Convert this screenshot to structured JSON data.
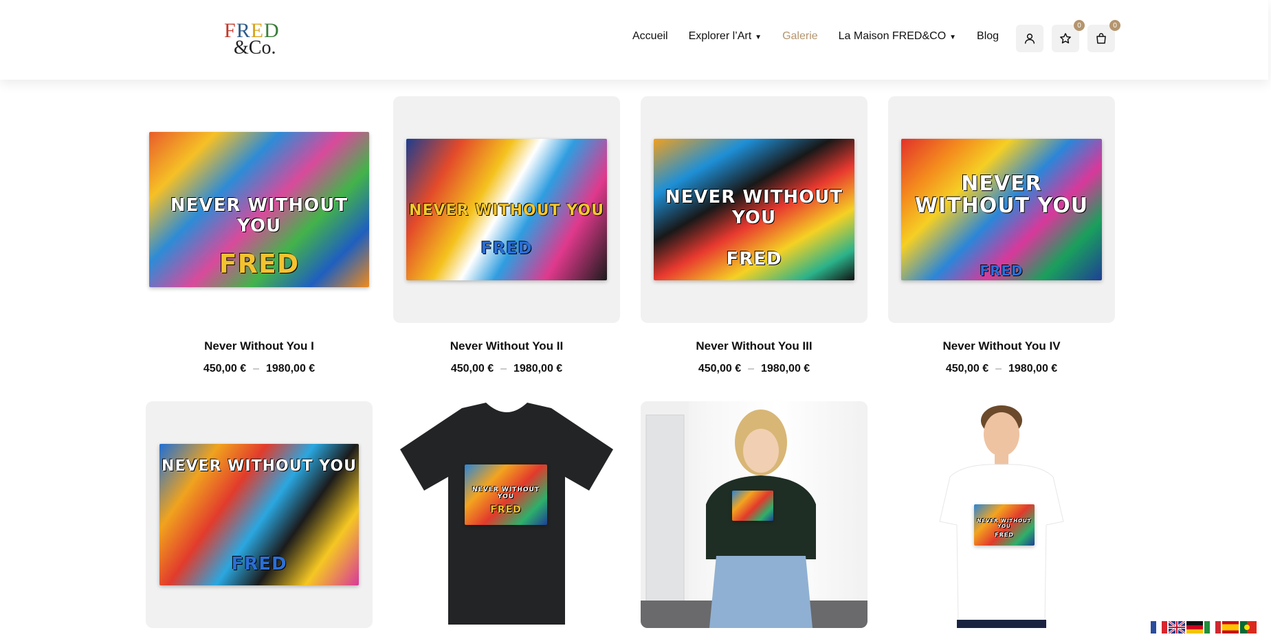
{
  "header": {
    "logo_line1": [
      "F",
      "R",
      "E",
      "D"
    ],
    "logo_line2": "&Co.",
    "nav": [
      {
        "label": "Accueil",
        "dropdown": false,
        "active": false
      },
      {
        "label": "Explorer l’Art",
        "dropdown": true,
        "active": false
      },
      {
        "label": "Galerie",
        "dropdown": false,
        "active": true
      },
      {
        "label": "La Maison FRED&CO",
        "dropdown": true,
        "active": false
      },
      {
        "label": "Blog",
        "dropdown": false,
        "active": false
      }
    ],
    "icons": [
      "user-icon",
      "star-icon",
      "bag-icon"
    ],
    "wishlist_count": "0",
    "cart_count": "0",
    "accent_color": "#b4956e"
  },
  "products": [
    {
      "title": "Never Without You I",
      "price_min": "450,00 €",
      "price_sep": "–",
      "price_max": "1980,00 €",
      "art_text": "NEVER WITHOUT YOU",
      "art_sign": "FRED"
    },
    {
      "title": "Never Without You II",
      "price_min": "450,00 €",
      "price_sep": "–",
      "price_max": "1980,00 €",
      "art_text": "NEVER WITHOUT YOU",
      "art_sign": "FRED"
    },
    {
      "title": "Never Without You III",
      "price_min": "450,00 €",
      "price_sep": "–",
      "price_max": "1980,00 €",
      "art_text": "NEVER WITHOUT YOU",
      "art_sign": "FRED"
    },
    {
      "title": "Never Without You IV",
      "price_min": "450,00 €",
      "price_sep": "–",
      "price_max": "1980,00 €",
      "art_text": "NEVER WITHOUT YOU",
      "art_sign": "FRED"
    },
    {
      "art_text": "NEVER WITHOUT YOU",
      "art_sign": "FRED"
    },
    {
      "art_text": "NEVER WITHOUT YOU",
      "art_sign": "FRED"
    },
    {
      "art_text": "",
      "art_sign": ""
    },
    {
      "art_text": "NEVER WITHOUT YOU",
      "art_sign": "FRED"
    }
  ],
  "languages": [
    "fr-flag-icon",
    "en-flag-icon",
    "de-flag-icon",
    "it-flag-icon",
    "es-flag-icon",
    "pt-flag-icon"
  ]
}
